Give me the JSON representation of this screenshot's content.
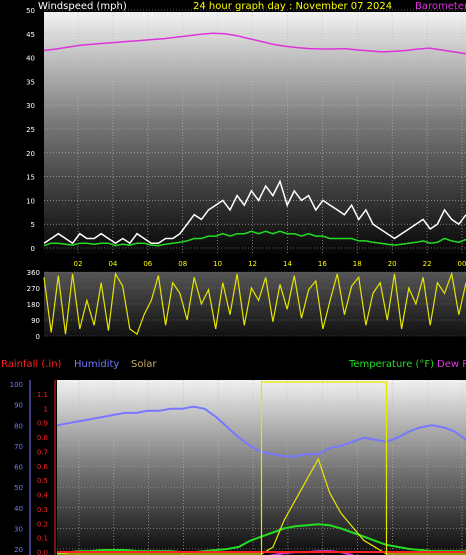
{
  "panel_top": {
    "left_title": "Windspeed (mph)",
    "center_title": "24 hour graph day : November 07 2024",
    "right_title": "Barometer"
  },
  "panel_bottom": {
    "rainfall_label": "Rainfall (.in)",
    "humidity_label": "Humidity",
    "solar_label": "Solar",
    "temperature_label": "Temperature (°F)",
    "dew_label": "Dew P"
  },
  "colors": {
    "wind": "#ffffff",
    "gust_avg": "#22dd22",
    "barometer": "#dd33dd",
    "direction": "#e6e600",
    "humidity": "#7777ff",
    "solar": "#e6e600",
    "temperature": "#22dd22",
    "dew": "#dd33dd",
    "rain": "#ff2222",
    "title_yellow": "#ffff00",
    "grid_label": "#ffffff"
  },
  "chart_data": [
    {
      "type": "line",
      "id": "wind",
      "xlabel": "",
      "x_ticks": [
        "02",
        "04",
        "06",
        "08",
        "10",
        "12",
        "14",
        "16",
        "18",
        "20",
        "22",
        "00"
      ],
      "ylim": [
        0,
        50
      ],
      "y_ticks": [
        "0",
        "5",
        "10",
        "15",
        "20",
        "25",
        "30",
        "35",
        "40",
        "45",
        "50"
      ],
      "grid": true,
      "series": [
        {
          "name": "Windspeed (mph)",
          "values": [
            1,
            2,
            3,
            2,
            1,
            3,
            2,
            2,
            3,
            2,
            1,
            2,
            1,
            3,
            2,
            1,
            1,
            2,
            2,
            3,
            5,
            7,
            6,
            8,
            9,
            10,
            8,
            11,
            9,
            12,
            10,
            13,
            11,
            14,
            9,
            12,
            10,
            11,
            8,
            10,
            9,
            8,
            7,
            9,
            6,
            8,
            5,
            4,
            3,
            2,
            3,
            4,
            5,
            6,
            4,
            5,
            8,
            6,
            5,
            7
          ]
        },
        {
          "name": "",
          "values": [
            0.5,
            1,
            1,
            0.8,
            0.6,
            1,
            1,
            0.8,
            1,
            1,
            0.5,
            0.8,
            0.6,
            1,
            1,
            0.6,
            0.5,
            0.8,
            1,
            1.2,
            1.5,
            2,
            2,
            2.5,
            2.5,
            3,
            2.5,
            3,
            3,
            3.5,
            3,
            3.5,
            3,
            3.5,
            3,
            3,
            2.5,
            3,
            2.5,
            2.5,
            2,
            2,
            2,
            2,
            1.5,
            1.5,
            1.2,
            1,
            0.8,
            0.6,
            0.8,
            1,
            1.2,
            1.5,
            1,
            1.2,
            2,
            1.5,
            1.2,
            1.8
          ]
        }
      ]
    },
    {
      "type": "line",
      "id": "barometer",
      "ylabel": "Barometer",
      "series": [
        {
          "name": "Barometer",
          "values": [
            41.5,
            41.8,
            42.2,
            42.6,
            42.8,
            43.0,
            43.2,
            43.4,
            43.6,
            43.8,
            44.0,
            44.3,
            44.6,
            44.9,
            45.1,
            45.0,
            44.6,
            44.0,
            43.4,
            42.8,
            42.4,
            42.1,
            41.9,
            41.8,
            41.8,
            41.9,
            41.6,
            41.4,
            41.2,
            41.3,
            41.5,
            41.8,
            42.0,
            41.6,
            41.2,
            40.8
          ]
        }
      ]
    },
    {
      "type": "line",
      "id": "direction",
      "ylim": [
        0,
        360
      ],
      "y_ticks": [
        "0",
        "90",
        "180",
        "270",
        "360"
      ],
      "grid": true,
      "series": [
        {
          "name": "",
          "values": [
            330,
            20,
            340,
            10,
            350,
            40,
            200,
            60,
            300,
            30,
            350,
            280,
            40,
            10,
            120,
            200,
            340,
            60,
            300,
            240,
            90,
            330,
            180,
            260,
            40,
            300,
            120,
            350,
            60,
            270,
            200,
            330,
            80,
            290,
            150,
            340,
            100,
            260,
            310,
            40,
            200,
            350,
            120,
            280,
            330,
            60,
            240,
            300,
            90,
            350,
            40,
            270,
            180,
            330,
            60,
            300,
            240,
            350,
            120,
            300
          ]
        }
      ]
    },
    {
      "type": "line",
      "id": "bottom",
      "ylim": [
        0,
        100
      ],
      "y_ticks": [
        "20",
        "30",
        "40",
        "50",
        "60",
        "70",
        "80",
        "90",
        "100"
      ],
      "rain_ticks": [
        "0.0",
        "0.1",
        "0.2",
        "0.3",
        "0.4",
        "0.5",
        "0.6",
        "0.7",
        "0.8",
        "0.9",
        "1",
        "1.1"
      ],
      "grid": true,
      "series": [
        {
          "name": "Humidity",
          "values": [
            80,
            81,
            82,
            83,
            84,
            85,
            86,
            86,
            87,
            87,
            88,
            88,
            89,
            88,
            84,
            79,
            74,
            70,
            67,
            66,
            65,
            65,
            66,
            66,
            69,
            70,
            72,
            74,
            73,
            72,
            74,
            77,
            79,
            80,
            79,
            77,
            73
          ]
        },
        {
          "name": "Temperature (°F)",
          "values": [
            18,
            18.5,
            19,
            19,
            19.5,
            19.5,
            19.5,
            19,
            19,
            19,
            19,
            18.5,
            18.5,
            19,
            19.5,
            20,
            21,
            24,
            26,
            28,
            30,
            31,
            31.5,
            32,
            31.5,
            30,
            28,
            26,
            24,
            22,
            21,
            20,
            19.5,
            19,
            19,
            19,
            19
          ]
        },
        {
          "name": "Dew P",
          "values": [
            12,
            12,
            12,
            12,
            12,
            12,
            12,
            12,
            12,
            12,
            12,
            12,
            12,
            12,
            12,
            12,
            12,
            14,
            16,
            17,
            18,
            18.5,
            18.5,
            19,
            19,
            18.5,
            17,
            15,
            14,
            13,
            12,
            12,
            12,
            12,
            12,
            12,
            12
          ]
        },
        {
          "name": "Solar",
          "values": [
            0,
            0,
            0,
            0,
            0,
            0,
            0,
            0,
            0,
            0,
            0,
            0,
            0,
            0,
            0,
            0,
            0,
            0,
            0,
            5,
            25,
            40,
            55,
            70,
            45,
            30,
            20,
            10,
            5,
            0,
            0,
            0,
            0,
            0,
            0,
            0,
            0
          ]
        },
        {
          "name": "Rainfall (.in)",
          "values": [
            0,
            0,
            0,
            0,
            0,
            0,
            0,
            0,
            0,
            0,
            0,
            0,
            0,
            0,
            0,
            0,
            0,
            0,
            0,
            0,
            0,
            0,
            0,
            0,
            0,
            0,
            0,
            0,
            0,
            0,
            0,
            0,
            0,
            0,
            0,
            0,
            0
          ]
        }
      ]
    }
  ]
}
